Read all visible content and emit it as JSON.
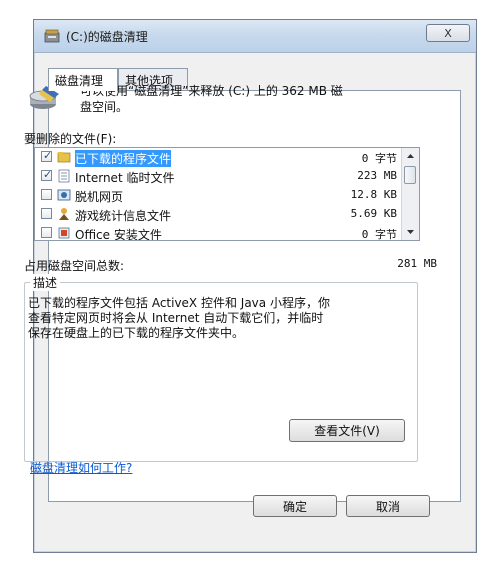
{
  "window": {
    "title": "(C:)的磁盘清理",
    "close_label": "X"
  },
  "tabs": [
    {
      "label": "磁盘清理"
    },
    {
      "label": "其他选项"
    }
  ],
  "info": {
    "line1": "可以使用“磁盘清理”来释放  (C:) 上的 362 MB 磁",
    "line2": "盘空间。"
  },
  "files_label": "要删除的文件(F):",
  "files": [
    {
      "name": "已下载的程序文件",
      "size": "0 字节",
      "checked": true,
      "icon": "folder-icon"
    },
    {
      "name": "Internet 临时文件",
      "size": "223 MB",
      "checked": true,
      "icon": "document-icon"
    },
    {
      "name": "脱机网页",
      "size": "12.8 KB",
      "checked": false,
      "icon": "offline-page-icon"
    },
    {
      "name": "游戏统计信息文件",
      "size": "5.69 KB",
      "checked": false,
      "icon": "game-stats-icon"
    },
    {
      "name": "Office 安装文件",
      "size": "0 字节",
      "checked": false,
      "icon": "office-setup-icon"
    }
  ],
  "total": {
    "label": "占用磁盘空间总数:",
    "value": "281 MB"
  },
  "description": {
    "legend": "描述",
    "line1": "已下载的程序文件包括 ActiveX 控件和 Java 小程序，你",
    "line2": "查看特定网页时将会从 Internet 自动下载它们，并临时",
    "line3": "保存在硬盘上的已下载的程序文件夹中。"
  },
  "view_files_label": "查看文件(V)",
  "help_link": "磁盘清理如何工作?",
  "buttons": {
    "ok": "确定",
    "cancel": "取消"
  }
}
